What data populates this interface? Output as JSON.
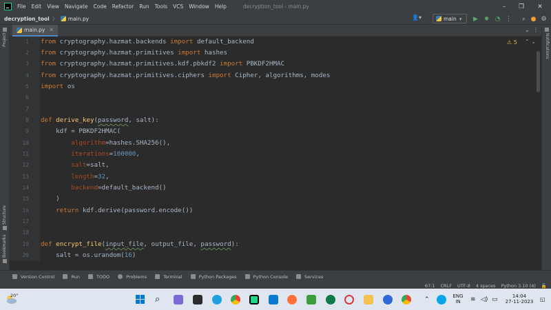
{
  "menubar": {
    "items": [
      "File",
      "Edit",
      "View",
      "Navigate",
      "Code",
      "Refactor",
      "Run",
      "Tools",
      "VCS",
      "Window",
      "Help"
    ],
    "window_title": "decryption_tool - main.py"
  },
  "navbar": {
    "project": "decryption_tool",
    "file": "main.py",
    "branch": "main"
  },
  "sidebar": {
    "left": [
      "Project",
      "Structure",
      "Bookmarks"
    ],
    "right": [
      "Notifications"
    ]
  },
  "tab": {
    "label": "main.py"
  },
  "editor": {
    "warnings": "5",
    "line_numbers": [
      "1",
      "2",
      "3",
      "4",
      "5",
      "6",
      "7",
      "8",
      "9",
      "10",
      "11",
      "12",
      "13",
      "14",
      "15",
      "16",
      "17",
      "18",
      "19",
      "20"
    ]
  },
  "toolwindows": [
    "Version Control",
    "Run",
    "TODO",
    "Problems",
    "Terminal",
    "Python Packages",
    "Python Console",
    "Services"
  ],
  "status": {
    "position": "67:1",
    "line_sep": "CRLF",
    "encoding": "UTF-8",
    "indent": "4 spaces",
    "interpreter": "Python 3.10 (4)"
  },
  "taskbar": {
    "temperature": "20°",
    "lang1": "ENG",
    "lang2": "IN",
    "time": "14:04",
    "date": "27-11-2023"
  },
  "colors": {
    "keyword": "#cc7832",
    "function": "#ffc66d",
    "param": "#aa4926",
    "number": "#6897bb",
    "text": "#a9b7c6"
  }
}
